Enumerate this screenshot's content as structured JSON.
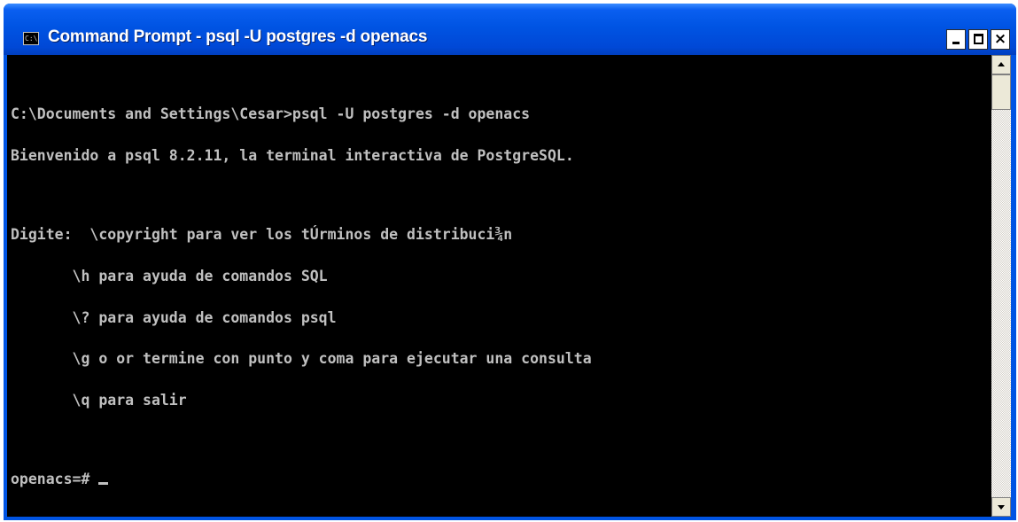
{
  "window": {
    "title": "Command Prompt - psql -U postgres -d openacs",
    "icon": "command-prompt-icon",
    "icon_glyph": "C:\\"
  },
  "titlebar_buttons": {
    "minimize": "minimize-icon",
    "maximize": "maximize-icon",
    "close": "close-icon",
    "close_glyph": "×"
  },
  "console": {
    "lines": [
      "C:\\Documents and Settings\\Cesar>psql -U postgres -d openacs",
      "Bienvenido a psql 8.2.11, la terminal interactiva de PostgreSQL.",
      "",
      "Digite:  \\copyright para ver los tÚrminos de distribuci¾n",
      "       \\h para ayuda de comandos SQL",
      "       \\? para ayuda de comandos psql",
      "       \\g o or termine con punto y coma para ejecutar una consulta",
      "       \\q para salir",
      "",
      "openacs=# "
    ],
    "colors": {
      "background": "#000000",
      "foreground": "#c0c0c0"
    }
  },
  "scrollbar": {
    "up_arrow": "scroll-up-arrow-icon",
    "down_arrow": "scroll-down-arrow-icon"
  },
  "colors": {
    "titlebar": "#0054e3",
    "title_text": "#ffffff"
  }
}
